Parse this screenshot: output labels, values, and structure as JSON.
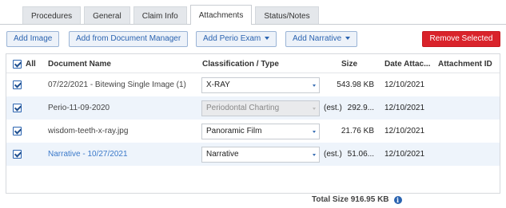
{
  "tabs": [
    "Procedures",
    "General",
    "Claim Info",
    "Attachments",
    "Status/Notes"
  ],
  "toolbar": {
    "add_image": "Add Image",
    "add_from_doc_manager": "Add from Document Manager",
    "add_perio_exam": "Add Perio Exam",
    "add_narrative": "Add Narrative",
    "remove_selected": "Remove Selected"
  },
  "columns": {
    "all": "All",
    "document_name": "Document Name",
    "classification": "Classification / Type",
    "size": "Size",
    "date_attached": "Date Attac...",
    "attachment_id": "Attachment ID"
  },
  "rows": [
    {
      "name": "07/22/2021 - Bitewing Single Image (1)",
      "type": "X-RAY",
      "est": "",
      "size": "543.98 KB",
      "date": "12/10/2021",
      "attachment_id": ""
    },
    {
      "name": "Perio-11-09-2020",
      "type": "Periodontal Charting",
      "est": "(est.)",
      "size": "292.9...",
      "date": "12/10/2021",
      "attachment_id": ""
    },
    {
      "name": "wisdom-teeth-x-ray.jpg",
      "type": "Panoramic Film",
      "est": "",
      "size": "21.76 KB",
      "date": "12/10/2021",
      "attachment_id": ""
    },
    {
      "name": "Narrative - 10/27/2021",
      "type": "Narrative",
      "est": "(est.)",
      "size": "51.06...",
      "date": "12/10/2021",
      "attachment_id": ""
    }
  ],
  "footer": {
    "total_size": "Total Size 916.95 KB",
    "info_glyph": "i"
  },
  "colors": {
    "accent": "#2a63b0",
    "danger": "#d9232b",
    "link": "#3a79c9",
    "row_alt": "#eef4fb"
  }
}
